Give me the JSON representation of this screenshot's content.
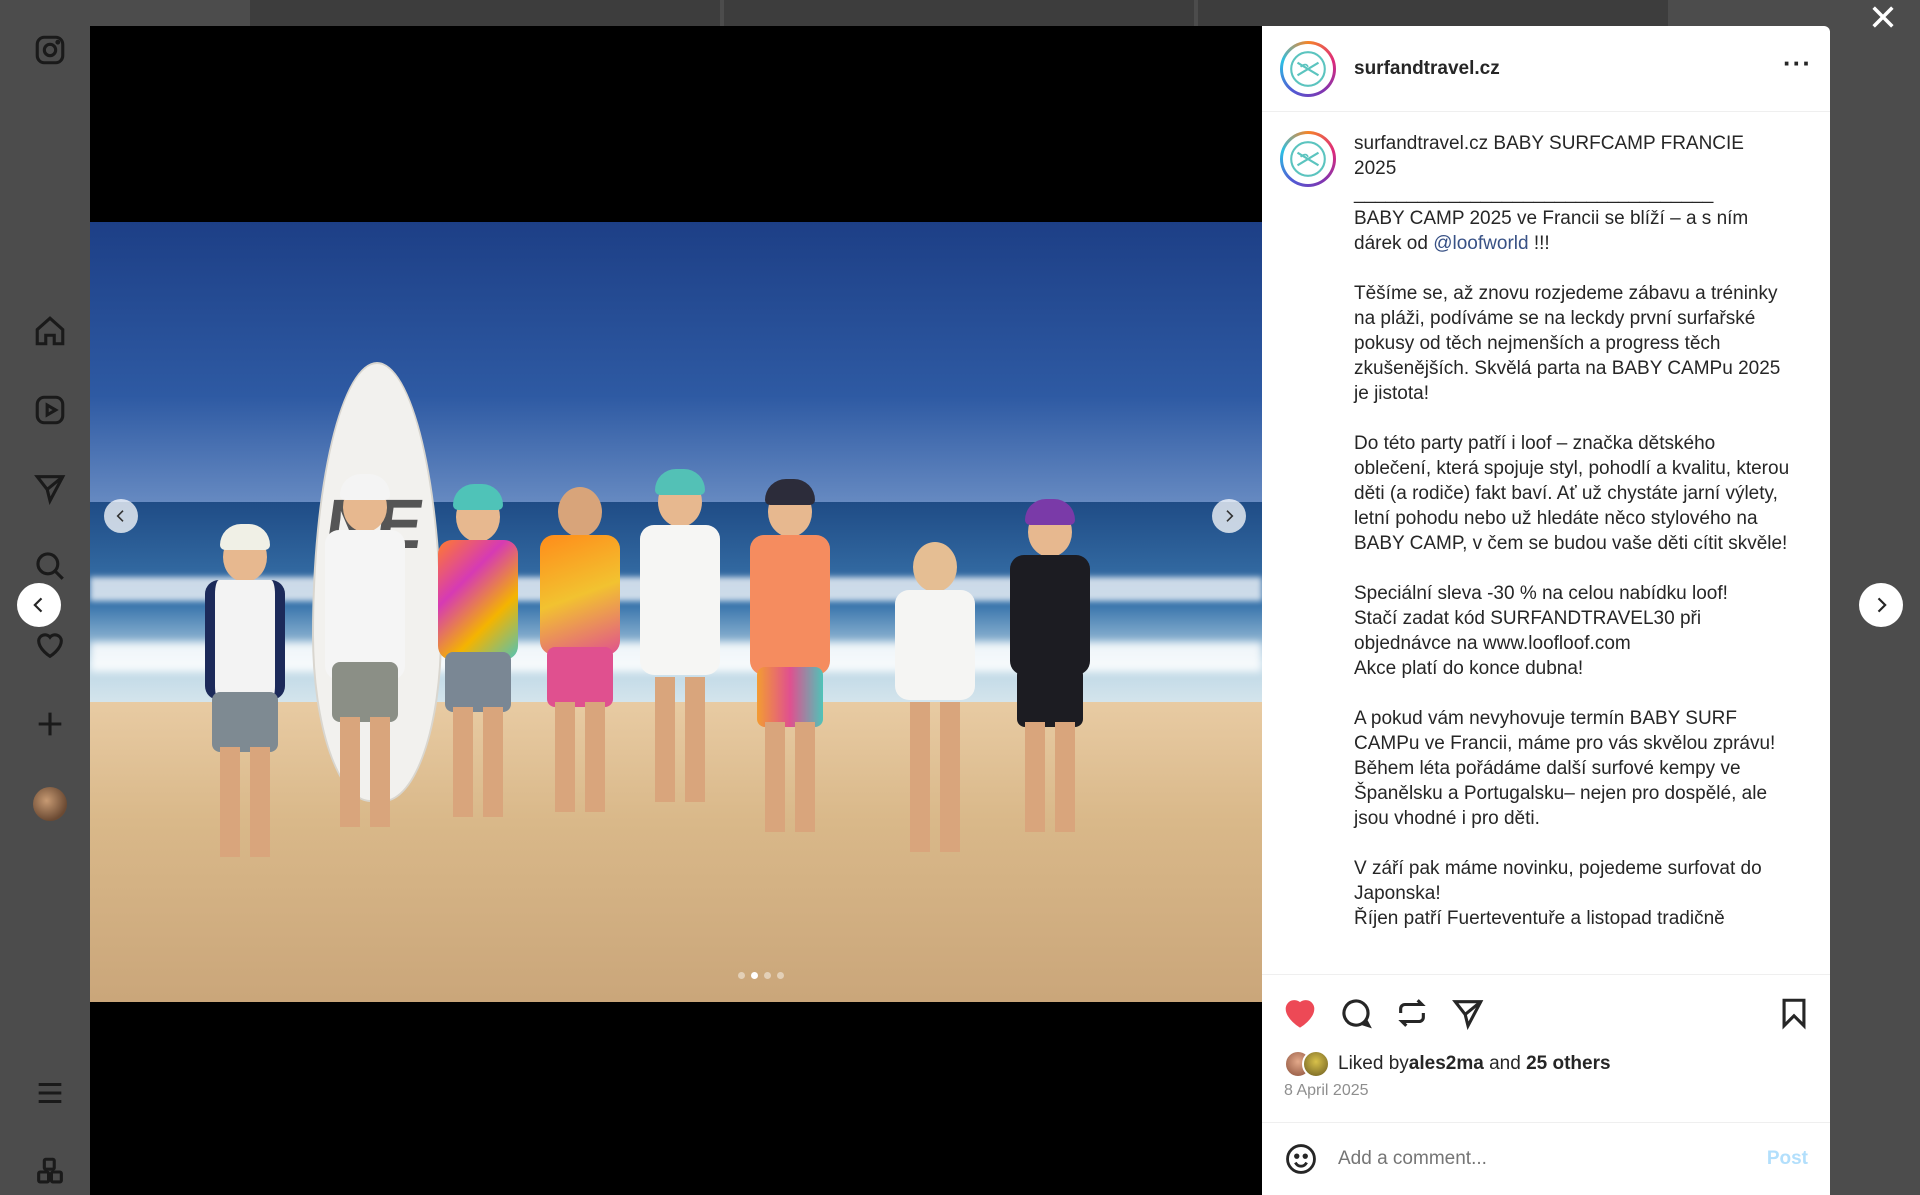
{
  "post": {
    "username": "surfandtravel.cz",
    "more_label": "···",
    "caption_user": "surfandtravel.cz",
    "caption_title": " BABY SURFCAMP FRANCIE 2025",
    "caption_rule": "__________________________________",
    "caption_p1_a": "BABY CAMP 2025 ve Francii se blíží – a s ním dárek od ",
    "caption_mention": "@loofworld",
    "caption_p1_b": " !!!",
    "caption_p2": "Těšíme se, až znovu rozjedeme zábavu a tréninky na pláži, podíváme se na leckdy první surfařské pokusy od těch nejmenších a progress těch zkušenějších. Skvělá parta na BABY CAMPu 2025 je jistota!",
    "caption_p3": "Do této party patří i loof – značka dětského oblečení, která spojuje styl, pohodlí a kvalitu, kterou děti (a rodiče) fakt baví. Ať už chystáte jarní výlety, letní pohodu nebo už hledáte něco stylového na BABY CAMP, v čem se budou vaše děti cítit skvěle!",
    "caption_p4": "Speciální sleva -30 % na celou nabídku loof!\nStačí zadat kód SURFANDTRAVEL30 při objednávce na www.loofloof.com\nAkce platí do konce dubna!",
    "caption_p5": "A pokud vám nevyhovuje termín BABY SURF CAMPu ve Francii, máme pro vás skvělou zprávu! Během léta pořádáme další surfové kempy ve Španělsku a Portugalsku– nejen pro dospělé, ale jsou vhodné i pro děti.",
    "caption_p6": "V září pak máme novinku, pojedeme surfovat do Japonska!\nŘíjen patří Fuerteventuře a listopad tradičně",
    "liked_prefix": "Liked by ",
    "liked_user": "ales2ma",
    "liked_and": " and ",
    "liked_others": "25 others",
    "date": "8 April 2025",
    "comment_placeholder": "Add a comment...",
    "post_label": "Post"
  },
  "carousel": {
    "total": 4,
    "active": 1
  },
  "icons": {
    "rail": [
      "instagram-icon",
      "home-icon",
      "reels-icon",
      "messages-icon",
      "search-icon",
      "notifications-icon",
      "create-icon",
      "profile-avatar",
      "menu-icon",
      "more-apps-icon"
    ],
    "actions": [
      "heart-icon",
      "comment-icon",
      "repost-icon",
      "share-icon",
      "bookmark-icon"
    ]
  },
  "colors": {
    "like": "#ed4956",
    "link": "#385185",
    "post_button": "#b2dffc"
  }
}
